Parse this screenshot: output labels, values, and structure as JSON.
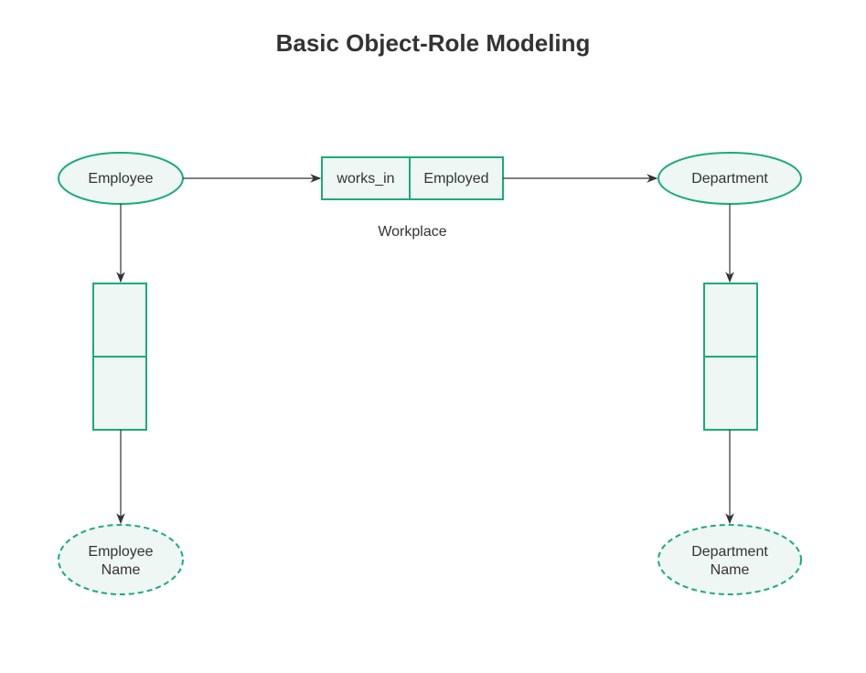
{
  "title": "Basic Object-Role Modeling",
  "entities": {
    "employee": "Employee",
    "department": "Department"
  },
  "roles": {
    "works_in": "works_in",
    "employed": "Employed",
    "workplace_label": "Workplace"
  },
  "values": {
    "employee_name_l1": "Employee",
    "employee_name_l2": "Name",
    "department_name_l1": "Department",
    "department_name_l2": "Name"
  },
  "colors": {
    "stroke": "#1aab7a",
    "fill": "#eef7f3",
    "text": "#333333"
  }
}
